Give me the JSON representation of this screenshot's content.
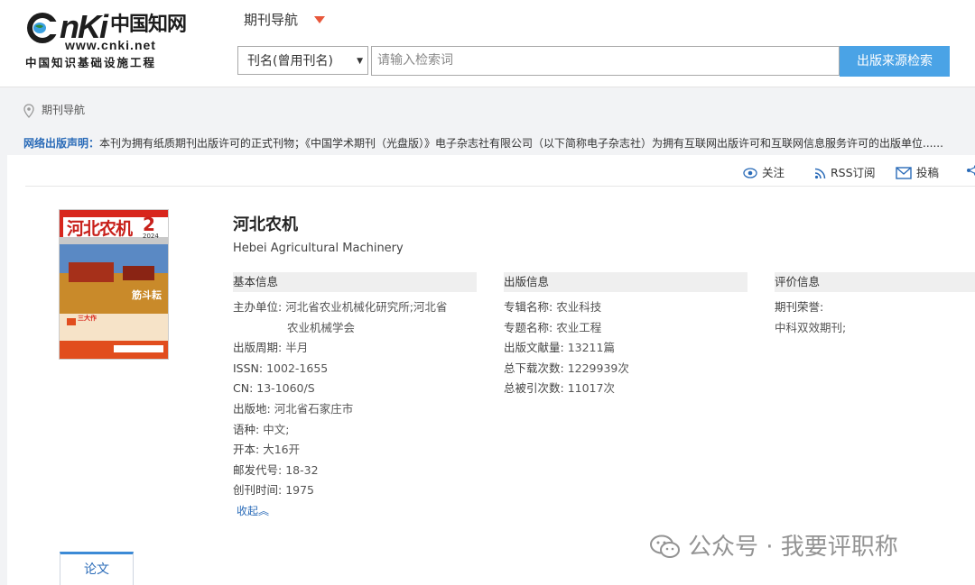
{
  "logo": {
    "brand": "CNKI",
    "brand_cn": "中国知网",
    "url": "www.cnki.net",
    "subtitle": "中国知识基础设施工程"
  },
  "header": {
    "nav_title": "期刊导航",
    "search_field": "刊名(曾用刊名)",
    "search_placeholder": "请输入检索词",
    "search_button": "出版来源检索"
  },
  "breadcrumb": {
    "label": "期刊导航"
  },
  "notice": {
    "label": "网络出版声明：",
    "text": "本刊为拥有纸质期刊出版许可的正式刊物；《中国学术期刊（光盘版）》电子杂志社有限公司（以下简称电子杂志社）为拥有互联网出版许可和互联网信息服务许可的出版单位......"
  },
  "toolbar": {
    "follow": "关注",
    "rss": "RSS订阅",
    "submit": "投稿"
  },
  "journal": {
    "title_cn": "河北农机",
    "title_en": "Hebei Agricultural Machinery",
    "cover": {
      "masthead": "河北农机",
      "issue": "2",
      "year": "2024",
      "headline": "筋斗耘",
      "tagline": "三大作"
    }
  },
  "basic_info": {
    "heading": "基本信息",
    "sponsor_label": "主办单位:",
    "sponsor_line1": "河北省农业机械化研究所;河北省",
    "sponsor_line2": "农业机械学会",
    "period_label": "出版周期:",
    "period": "半月",
    "issn_label": "ISSN:",
    "issn": "1002-1655",
    "cn_label": "CN:",
    "cn": "13-1060/S",
    "place_label": "出版地:",
    "place": "河北省石家庄市",
    "lang_label": "语种:",
    "lang": "中文;",
    "format_label": "开本:",
    "format": "大16开",
    "postal_label": "邮发代号:",
    "postal": "18-32",
    "founded_label": "创刊时间:",
    "founded": "1975",
    "collapse": "收起"
  },
  "publish_info": {
    "heading": "出版信息",
    "series_label": "专辑名称:",
    "series": "农业科技",
    "topic_label": "专题名称:",
    "topic": "农业工程",
    "docs_label": "出版文献量:",
    "docs": "13211篇",
    "downloads_label": "总下载次数:",
    "downloads": "1229939次",
    "citations_label": "总被引次数:",
    "citations": "11017次"
  },
  "eval_info": {
    "heading": "评价信息",
    "honor_label": "期刊荣誉:",
    "honor": "中科双效期刊;"
  },
  "tabs": {
    "papers": "论文"
  },
  "watermark": {
    "text": "公众号 · 我要评职称"
  }
}
